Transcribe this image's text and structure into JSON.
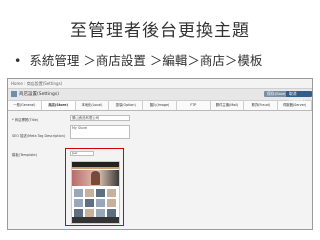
{
  "slide": {
    "title": "至管理者後台更換主題",
    "bullet": "系統管理 ＞商店設置 ＞編輯＞商店＞模板"
  },
  "screen": {
    "breadcrumb": "Home : 商店設置(Settings)",
    "header_title": "商店設置(Settings)",
    "save_label": "保存(Save)",
    "cancel_label": "取消(Cancel)",
    "tabs": [
      "一般(General)",
      "商店(Store)",
      "本地化(Local)",
      "選項(Option)",
      "圖片(Image)",
      "FTP",
      "郵件主機(Mail)",
      "欺詐(Fraud)",
      "伺服器(Server)"
    ],
    "active_tab": 1,
    "fields": {
      "title_label": "* 商店標題(Title)",
      "title_value": "勝山食品有限公司",
      "meta_label": "SEO 描述(Meta Tag Description)",
      "meta_value": "My Store",
      "template_label": "模板(Template)",
      "template_value": "Jovi"
    },
    "colors": {
      "highlight": "#d40000",
      "cancel_button": "#2f5d8c"
    }
  }
}
